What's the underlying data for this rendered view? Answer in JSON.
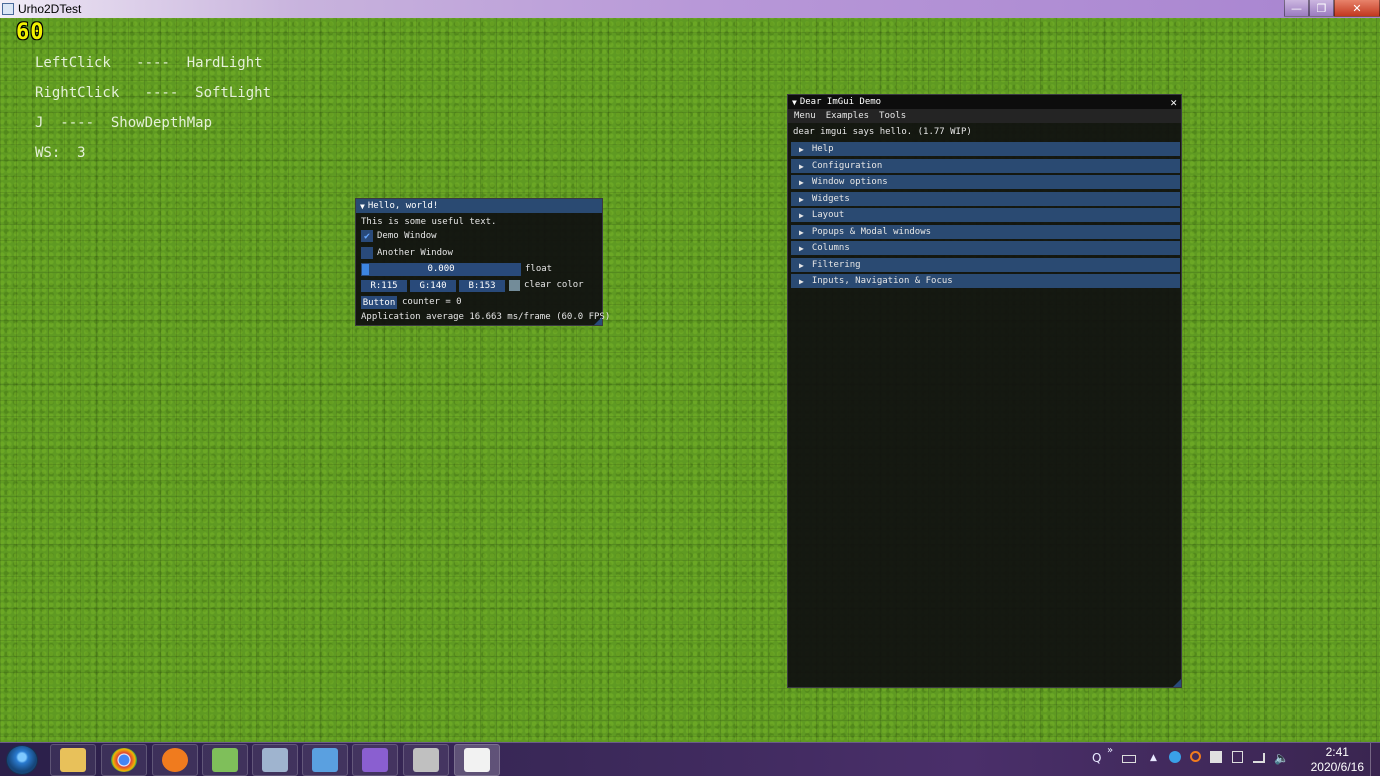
{
  "window": {
    "title": "Urho2DTest",
    "controls": {
      "minimize": "—",
      "maximize": "❐",
      "close": "✕"
    }
  },
  "overlay": {
    "fps": "60",
    "lines": [
      "LeftClick   ----  HardLight",
      "RightClick   ----  SoftLight",
      "J  ----  ShowDepthMap",
      "WS:  3"
    ]
  },
  "hello_window": {
    "title": "Hello, world!",
    "text": "This is some useful text.",
    "demo_window": {
      "label": "Demo Window",
      "checked": true,
      "check_glyph": "✔"
    },
    "another_window": {
      "label": "Another Window",
      "checked": false
    },
    "slider": {
      "value": "0.000",
      "label": "float",
      "fraction": 0.0
    },
    "color": {
      "r": "R:115",
      "g": "G:140",
      "b": "B:153",
      "label": "clear color",
      "hex": "#738c99"
    },
    "button": {
      "label": "Button",
      "counter_text": "counter = 0"
    },
    "stats": "Application average 16.663 ms/frame (60.0 FPS)"
  },
  "demo_window": {
    "title": "Dear ImGui Demo",
    "menu": [
      "Menu",
      "Examples",
      "Tools"
    ],
    "hello": "dear imgui says hello. (1.77 WIP)",
    "headers": [
      "Help",
      "Configuration",
      "Window options",
      "Widgets",
      "Layout",
      "Popups & Modal windows",
      "Columns",
      "Filtering",
      "Inputs, Navigation & Focus"
    ]
  },
  "taskbar": {
    "apps": [
      {
        "icon": "folder-icon",
        "color": "#e8c15a"
      },
      {
        "icon": "chrome-icon",
        "color": "#db4437"
      },
      {
        "icon": "search-app-icon",
        "color": "#f07b1e"
      },
      {
        "icon": "notepad-icon",
        "color": "#7fbf5a"
      },
      {
        "icon": "calculator-icon",
        "color": "#9fb4cf"
      },
      {
        "icon": "remote-desktop-icon",
        "color": "#5aa0e0"
      },
      {
        "icon": "visual-studio-icon",
        "color": "#8a5fd0"
      },
      {
        "icon": "game-app-icon",
        "color": "#c0c0c0"
      },
      {
        "icon": "calendar-icon",
        "color": "#f2f2f2"
      }
    ],
    "tray": {
      "q": "Q",
      "overflow": "»",
      "up_arrow": "▲",
      "volume": "🔈"
    },
    "clock": {
      "time": "2:41",
      "date": "2020/6/16"
    }
  }
}
